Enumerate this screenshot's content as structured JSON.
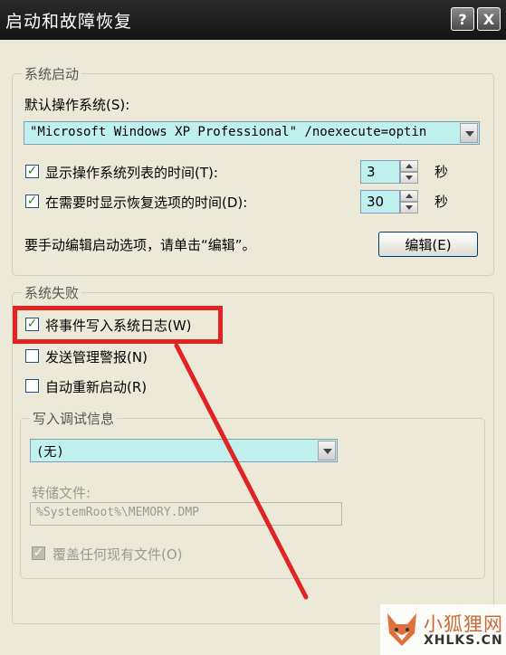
{
  "window": {
    "title": "启动和故障恢复",
    "help_label": "?",
    "close_label": "X"
  },
  "startup": {
    "group_label": "系统启动",
    "default_os_label": "默认操作系统(S):",
    "default_os_value": "\"Microsoft Windows XP Professional\" /noexecute=optin",
    "show_list_label": "显示操作系统列表的时间(T):",
    "show_list_checked": true,
    "show_list_value": "3",
    "show_list_unit": "秒",
    "show_recovery_label": "在需要时显示恢复选项的时间(D):",
    "show_recovery_checked": true,
    "show_recovery_value": "30",
    "show_recovery_unit": "秒",
    "manual_edit_text": "要手动编辑启动选项，请单击“编辑”。",
    "edit_button_label": "编辑(E)"
  },
  "failure": {
    "group_label": "系统失败",
    "write_event_label": "将事件写入系统日志(W)",
    "write_event_checked": true,
    "send_alert_label": "发送管理警报(N)",
    "send_alert_checked": false,
    "auto_restart_label": "自动重新启动(R)",
    "auto_restart_checked": false
  },
  "debug": {
    "group_label": "写入调试信息",
    "dropdown_value": "(无)",
    "dump_file_label": "转储文件:",
    "dump_file_value": "%SystemRoot%\\MEMORY.DMP",
    "overwrite_label": "覆盖任何现有文件(O)",
    "overwrite_checked": true
  },
  "watermark": {
    "cn": "小狐狸网",
    "en": "XHLKS.CN"
  },
  "colors": {
    "highlight": "#e02424",
    "field_bg": "#bff0ee",
    "titlebar": "#1e1e1e"
  }
}
